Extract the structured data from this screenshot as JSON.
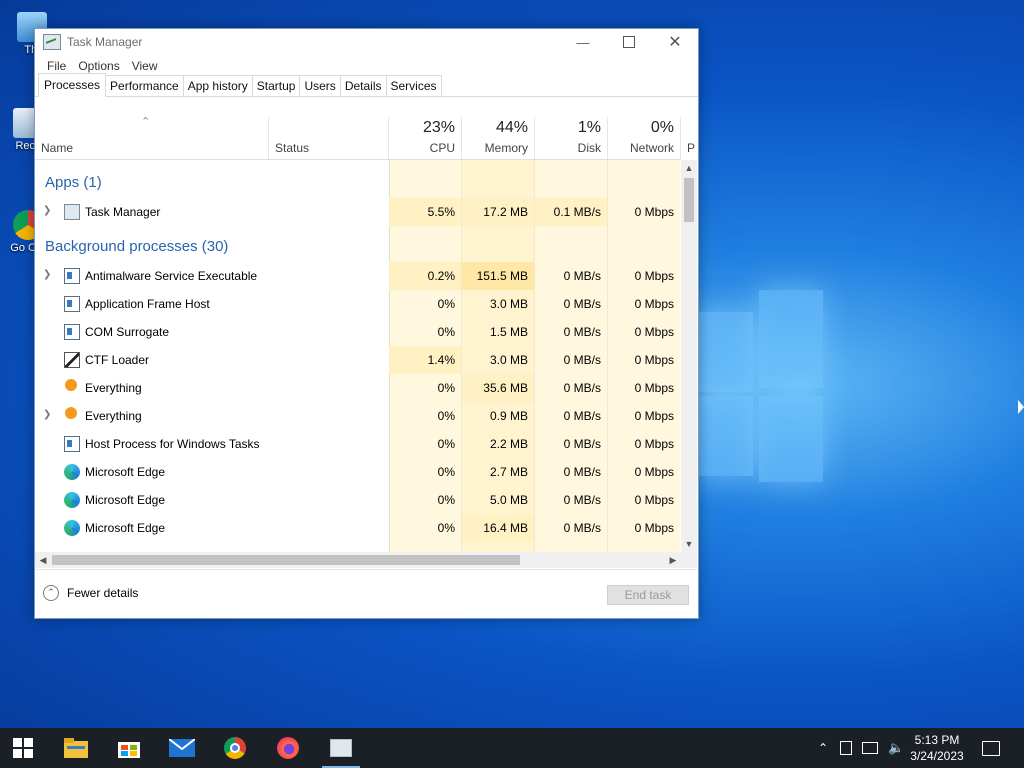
{
  "desktop": {
    "icons": [
      {
        "label": "Thi"
      },
      {
        "label": "Recy"
      },
      {
        "label": "Go Chr"
      }
    ]
  },
  "window": {
    "title": "Task Manager",
    "menus": [
      "File",
      "Options",
      "View"
    ],
    "tabs": [
      "Processes",
      "Performance",
      "App history",
      "Startup",
      "Users",
      "Details",
      "Services"
    ],
    "active_tab": "Processes"
  },
  "columns": {
    "name": "Name",
    "status": "Status",
    "cpu": {
      "pct": "23%",
      "label": "CPU"
    },
    "memory": {
      "pct": "44%",
      "label": "Memory"
    },
    "disk": {
      "pct": "1%",
      "label": "Disk"
    },
    "network": {
      "pct": "0%",
      "label": "Network"
    },
    "power_partial": "P"
  },
  "groups": {
    "apps": "Apps (1)",
    "background": "Background processes (30)"
  },
  "apps": [
    {
      "name": "Task Manager",
      "cpu": "5.5%",
      "memory": "17.2 MB",
      "disk": "0.1 MB/s",
      "network": "0 Mbps",
      "icon": "task-manager-icon",
      "expandable": true
    }
  ],
  "background": [
    {
      "name": "Antimalware Service Executable",
      "cpu": "0.2%",
      "memory": "151.5 MB",
      "disk": "0 MB/s",
      "network": "0 Mbps",
      "icon": "window-icon",
      "expandable": true
    },
    {
      "name": "Application Frame Host",
      "cpu": "0%",
      "memory": "3.0 MB",
      "disk": "0 MB/s",
      "network": "0 Mbps",
      "icon": "window-icon",
      "expandable": false
    },
    {
      "name": "COM Surrogate",
      "cpu": "0%",
      "memory": "1.5 MB",
      "disk": "0 MB/s",
      "network": "0 Mbps",
      "icon": "window-icon",
      "expandable": false
    },
    {
      "name": "CTF Loader",
      "cpu": "1.4%",
      "memory": "3.0 MB",
      "disk": "0 MB/s",
      "network": "0 Mbps",
      "icon": "pen-icon",
      "expandable": false
    },
    {
      "name": "Everything",
      "cpu": "0%",
      "memory": "35.6 MB",
      "disk": "0 MB/s",
      "network": "0 Mbps",
      "icon": "search-icon",
      "expandable": false
    },
    {
      "name": "Everything",
      "cpu": "0%",
      "memory": "0.9 MB",
      "disk": "0 MB/s",
      "network": "0 Mbps",
      "icon": "search-icon",
      "expandable": true
    },
    {
      "name": "Host Process for Windows Tasks",
      "cpu": "0%",
      "memory": "2.2 MB",
      "disk": "0 MB/s",
      "network": "0 Mbps",
      "icon": "window-icon",
      "expandable": false
    },
    {
      "name": "Microsoft Edge",
      "cpu": "0%",
      "memory": "2.7 MB",
      "disk": "0 MB/s",
      "network": "0 Mbps",
      "icon": "edge-icon",
      "expandable": false
    },
    {
      "name": "Microsoft Edge",
      "cpu": "0%",
      "memory": "5.0 MB",
      "disk": "0 MB/s",
      "network": "0 Mbps",
      "icon": "edge-icon",
      "expandable": false
    },
    {
      "name": "Microsoft Edge",
      "cpu": "0%",
      "memory": "16.4 MB",
      "disk": "0 MB/s",
      "network": "0 Mbps",
      "icon": "edge-icon",
      "expandable": false
    }
  ],
  "footer": {
    "fewer_details": "Fewer details",
    "end_task": "End task"
  },
  "taskbar": {
    "clock_time": "5:13 PM",
    "clock_date": "3/24/2023"
  },
  "colors": {
    "group_text": "#2a63b0",
    "heat_light": "#fff8df",
    "heat_mid": "#fff1c4",
    "heat_strong": "#ffe8a6"
  }
}
